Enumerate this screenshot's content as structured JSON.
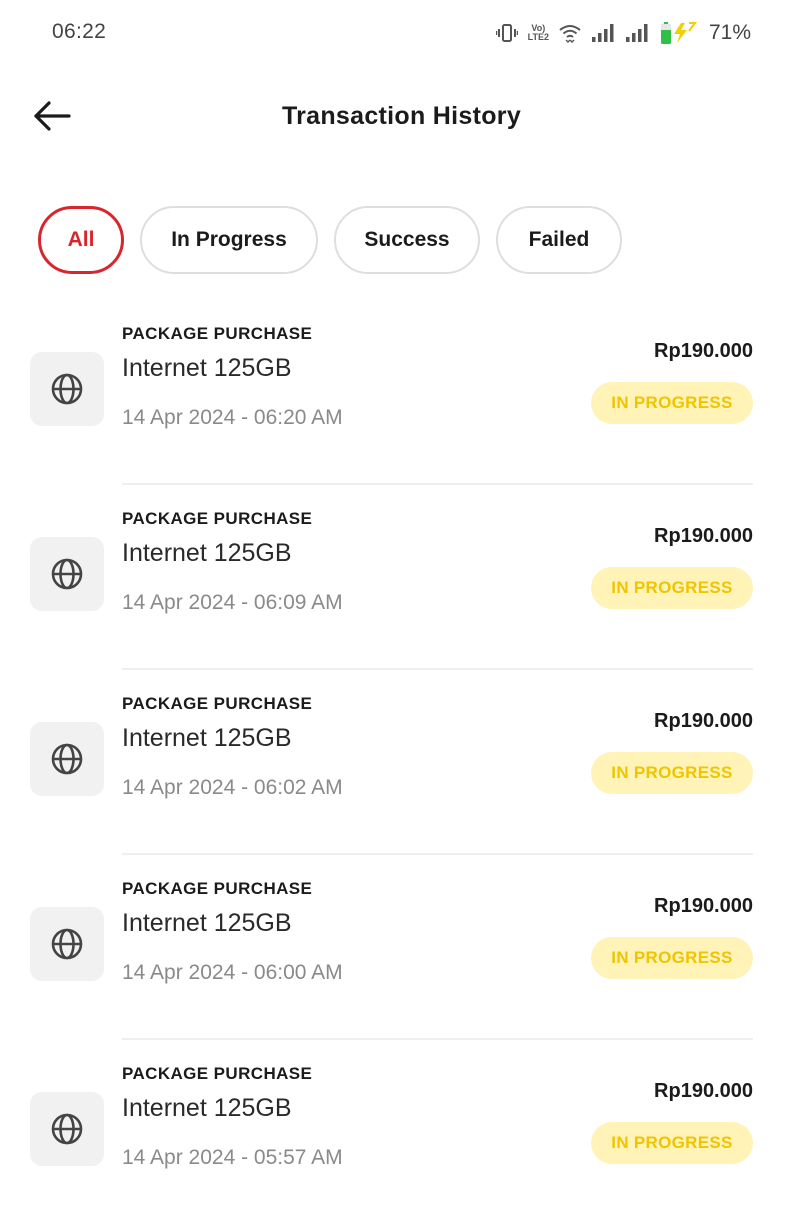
{
  "status_bar": {
    "time": "06:22",
    "lte_top": "Vo)",
    "lte_bottom": "LTE2",
    "battery_percent": "71%",
    "icons": [
      "vibrate-icon",
      "volte-icon",
      "wifi-icon",
      "signal-icon",
      "signal-icon",
      "battery-charging-icon"
    ]
  },
  "header": {
    "title": "Transaction History",
    "back_icon": "arrow-left-icon"
  },
  "filters": [
    {
      "label": "All",
      "active": true
    },
    {
      "label": "In Progress",
      "active": false
    },
    {
      "label": "Success",
      "active": false
    },
    {
      "label": "Failed",
      "active": false
    }
  ],
  "colors": {
    "accent": "#d8262f",
    "status_bg": "#fff3b8",
    "status_text": "#f0c400"
  },
  "transactions": [
    {
      "type": "PACKAGE PURCHASE",
      "name": "Internet 125GB",
      "date": "14 Apr 2024 - 06:20 AM",
      "amount": "Rp190.000",
      "status": "IN PROGRESS",
      "icon": "globe-icon"
    },
    {
      "type": "PACKAGE PURCHASE",
      "name": "Internet 125GB",
      "date": "14 Apr 2024 - 06:09 AM",
      "amount": "Rp190.000",
      "status": "IN PROGRESS",
      "icon": "globe-icon"
    },
    {
      "type": "PACKAGE PURCHASE",
      "name": "Internet 125GB",
      "date": "14 Apr 2024 - 06:02 AM",
      "amount": "Rp190.000",
      "status": "IN PROGRESS",
      "icon": "globe-icon"
    },
    {
      "type": "PACKAGE PURCHASE",
      "name": "Internet 125GB",
      "date": "14 Apr 2024 - 06:00 AM",
      "amount": "Rp190.000",
      "status": "IN PROGRESS",
      "icon": "globe-icon"
    },
    {
      "type": "PACKAGE PURCHASE",
      "name": "Internet 125GB",
      "date": "14 Apr 2024 - 05:57 AM",
      "amount": "Rp190.000",
      "status": "IN PROGRESS",
      "icon": "globe-icon"
    }
  ]
}
